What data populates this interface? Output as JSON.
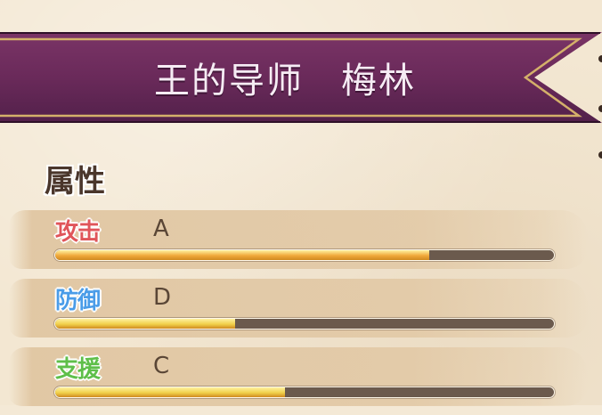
{
  "banner": {
    "title": "王的导师　梅林"
  },
  "attributes": {
    "heading": "属性",
    "stats": [
      {
        "label": "攻击",
        "grade": "A",
        "level": 0.75,
        "label_color": "#e0555a",
        "fill_color": "#f0a83a"
      },
      {
        "label": "防御",
        "grade": "D",
        "level": 0.36,
        "label_color": "#4a9ce8",
        "fill_color": "#f0d04a"
      },
      {
        "label": "支援",
        "grade": "C",
        "level": 0.46,
        "label_color": "#5fbf4a",
        "fill_color": "#f0d04a"
      }
    ]
  },
  "colors": {
    "banner_purple": "#6a2a58",
    "banner_border": "#c9a25a",
    "text_dark": "#4a362b"
  }
}
